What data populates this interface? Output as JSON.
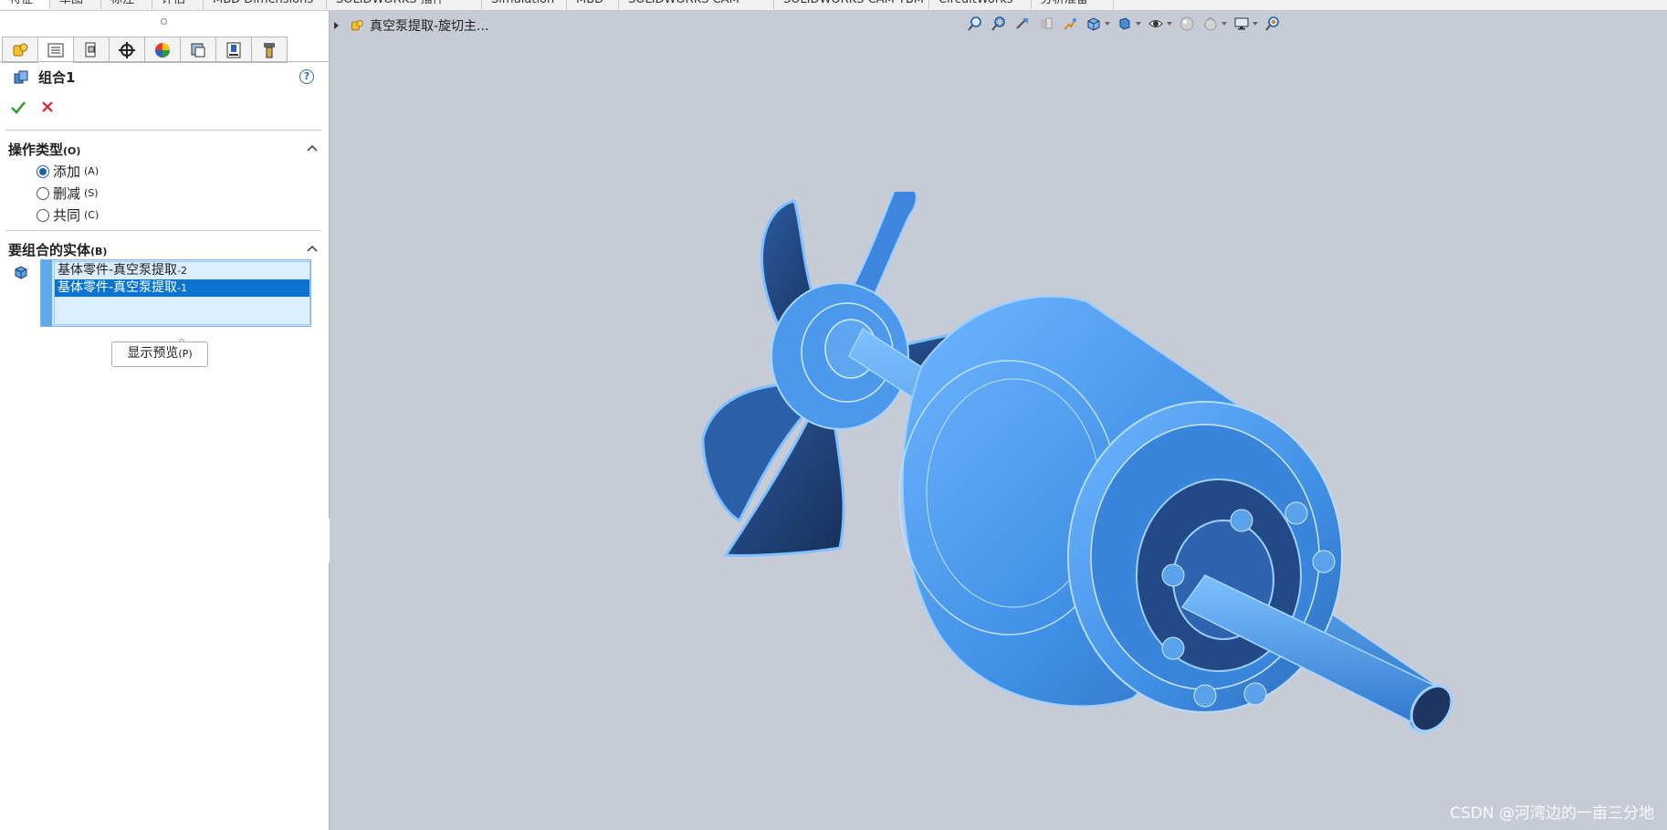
{
  "top_tabs": [
    "特征",
    "草图",
    "标注",
    "评估",
    "MBD Dimensions",
    "SOLIDWORKS 插件",
    "Simulation",
    "MBD",
    "SOLIDWORKS CAM",
    "SOLIDWORKS CAM TBM",
    "CircuitWorks",
    "分析准备"
  ],
  "panel": {
    "icon_tabs": [
      "feature-manager-tab-icon",
      "property-manager-tab-icon",
      "configuration-manager-tab-icon",
      "dimxpert-manager-tab-icon",
      "display-manager-tab-icon",
      "cam-feature-tree-tab-icon",
      "cam-operation-tree-tab-icon",
      "cam-tool-tree-tab-icon"
    ],
    "title": "组合1",
    "help": "?",
    "operation_group": {
      "label": "操作类型",
      "accel": "(O)",
      "options": [
        {
          "label": "添加",
          "accel": "(A)",
          "selected": true
        },
        {
          "label": "删减",
          "accel": "(S)",
          "selected": false
        },
        {
          "label": "共同",
          "accel": "(C)",
          "selected": false
        }
      ]
    },
    "bodies_group": {
      "label": "要组合的实体",
      "accel": "(B)",
      "items": [
        {
          "label": "基体零件-真空泵提取",
          "suffix": "-2",
          "selected": false
        },
        {
          "label": "基体零件-真空泵提取",
          "suffix": "-1",
          "selected": true
        }
      ]
    },
    "preview_button": {
      "label": "显示预览",
      "accel": "(P)"
    }
  },
  "viewport": {
    "breadcrumb": "真空泵提取-旋切主...",
    "hud_icons": [
      "zoom-to-fit-icon",
      "zoom-to-area-icon",
      "previous-view-icon",
      "section-view-icon",
      "dynamic-annotation-icon",
      "view-orientation-icon",
      "display-style-icon",
      "hide-show-items-icon",
      "edit-appearance-icon",
      "apply-scene-icon",
      "view-settings-icon",
      "realview-icon"
    ],
    "watermark": "CSDN @河湾边的一亩三分地",
    "colors": {
      "model": "#4a9cf0",
      "model_dark": "#1d3560",
      "edges": "#9bd0ff",
      "background": "#c6cbd6"
    }
  }
}
